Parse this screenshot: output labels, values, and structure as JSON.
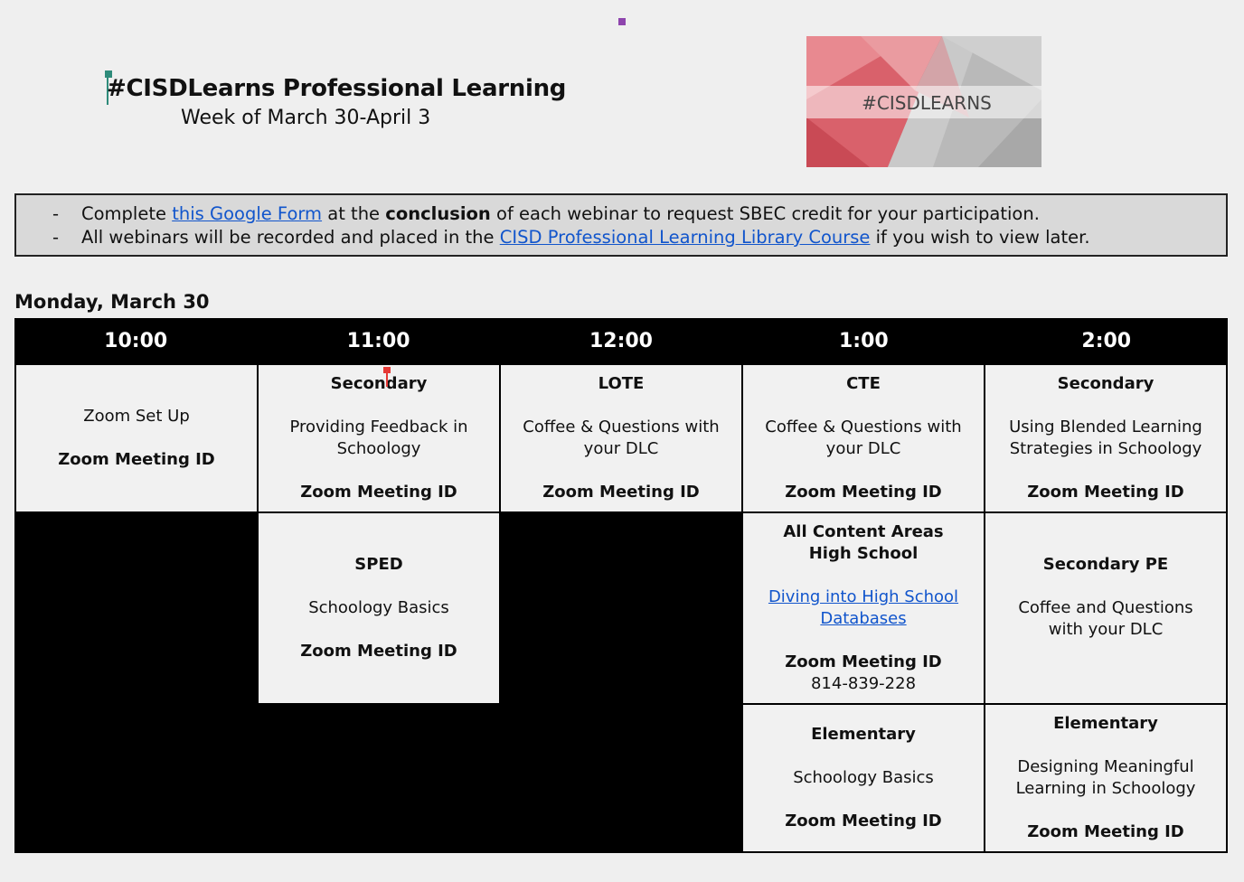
{
  "header": {
    "title": "#CISDLearns Professional Learning",
    "subtitle": "Week of March 30-April 3",
    "banner_text": "#CISDLEARNS"
  },
  "notice": {
    "line1": {
      "prefix": "Complete ",
      "link": "this Google Form",
      "mid": " at the ",
      "bold": "conclusion",
      "suffix": " of each webinar to request SBEC credit for your participation."
    },
    "line2": {
      "prefix": "All webinars will be recorded and placed in the ",
      "link": "CISD Professional Learning Library Course",
      "suffix": " if you wish to view later."
    },
    "bullet": "-"
  },
  "day": {
    "heading": "Monday, March 30"
  },
  "times": [
    "10:00",
    "11:00",
    "12:00",
    "1:00",
    "2:00"
  ],
  "sessions": {
    "s10_1": {
      "title": "Zoom Set Up",
      "zoom": "Zoom Meeting ID"
    },
    "s11_1": {
      "audience": "Secondary",
      "title": "Providing Feedback in Schoology",
      "zoom": "Zoom Meeting ID"
    },
    "s12_1": {
      "audience": "LOTE",
      "title": "Coffee & Questions with your DLC",
      "zoom": "Zoom Meeting ID"
    },
    "s1_1": {
      "audience": "CTE",
      "title": "Coffee & Questions with your DLC",
      "zoom": "Zoom Meeting ID"
    },
    "s2_1": {
      "audience": "Secondary",
      "title": "Using Blended Learning Strategies in Schoology",
      "zoom": "Zoom Meeting ID"
    },
    "s11_2": {
      "audience": "SPED",
      "title": "Schoology Basics",
      "zoom": "Zoom Meeting ID"
    },
    "s1_2": {
      "audience": "All Content Areas High School",
      "title": "Diving into High School Databases",
      "zoom": "Zoom Meeting ID",
      "id": "814-839-228"
    },
    "s2_2": {
      "audience": "Secondary PE",
      "title": "Coffee and Questions with your DLC"
    },
    "s1_3": {
      "audience": "Elementary",
      "title": "Schoology Basics",
      "zoom": "Zoom Meeting ID"
    },
    "s2_3": {
      "audience": "Elementary",
      "title": "Designing Meaningful Learning in Schoology",
      "zoom": "Zoom Meeting ID"
    }
  },
  "colors": {
    "link": "#1155cc",
    "page_bg": "#efefef",
    "notice_bg": "#d9d9d9",
    "grid_bg": "#000000",
    "cell_bg": "#f1f1f1"
  }
}
